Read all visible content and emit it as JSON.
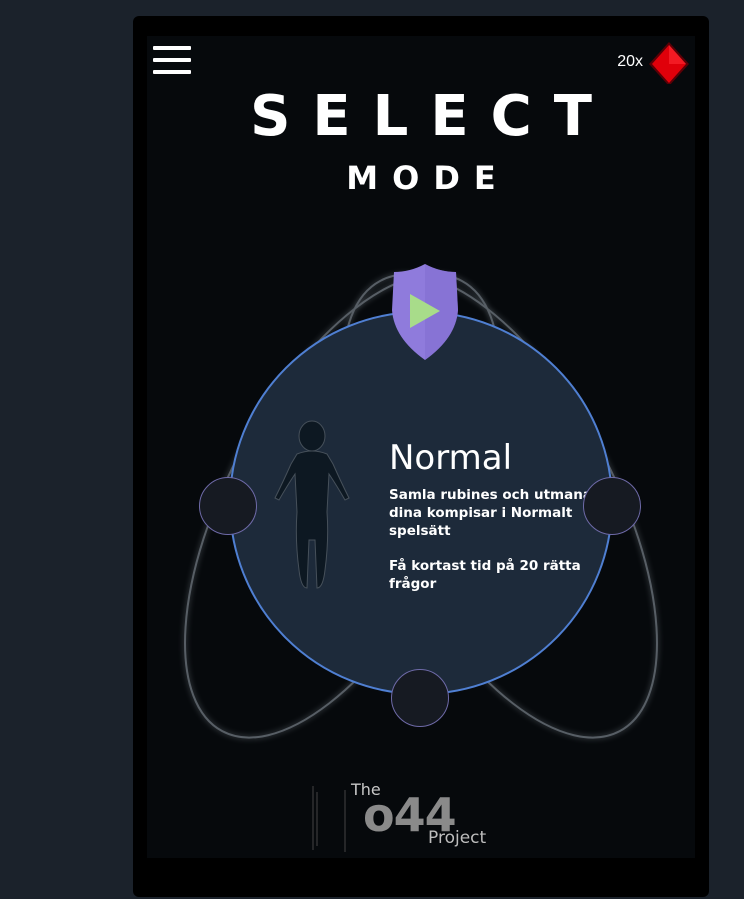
{
  "header": {
    "ruby_count": "20x",
    "title": "SELECT",
    "subtitle": "MODE"
  },
  "mode": {
    "name": "Normal",
    "description": "Samla rubines och utmana dina kompisar i Normalt spelsätt",
    "goal": "Få kortast tid på 20 rätta frågor"
  },
  "logo": {
    "prefix": "The",
    "number": "o44",
    "suffix": "Project"
  },
  "colors": {
    "ruby": "#e0000a",
    "accent_blue": "#4f7fd2",
    "shield": "#8f7bdc",
    "play": "#a8dc8a",
    "card": "#1d2a3a"
  },
  "icons": {
    "menu": "hamburger-icon",
    "currency": "ruby-icon",
    "play": "play-icon",
    "avatar": "human-silhouette-icon"
  }
}
